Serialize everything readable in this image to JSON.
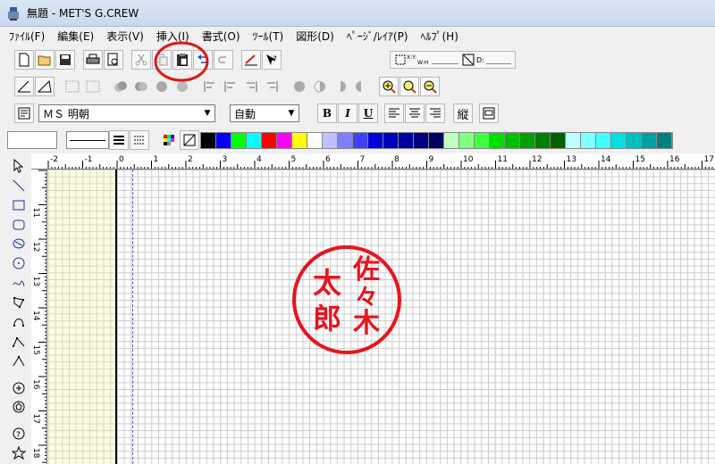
{
  "window": {
    "title": "無題 - MET'S G.CREW"
  },
  "menu": [
    {
      "label": "ﾌｧｲﾙ(F)"
    },
    {
      "label": "編集(E)"
    },
    {
      "label": "表示(V)"
    },
    {
      "label": "挿入(I)"
    },
    {
      "label": "書式(O)"
    },
    {
      "label": "ﾂｰﾙ(T)"
    },
    {
      "label": "図形(D)"
    },
    {
      "label": "ﾍﾟｰｼﾞ/ﾚｲｱ(P)"
    },
    {
      "label": "ﾍﾙﾌﾟ(H)"
    }
  ],
  "font_toolbar": {
    "font_name": "ＭＳ 明朝",
    "font_size": "自動",
    "bold": "B",
    "italic": "I",
    "underline": "U",
    "vertical": "縦"
  },
  "coord_panel": {
    "d_label": "D:"
  },
  "ruler": {
    "h_labels": [
      "-2",
      "-1",
      "0",
      "1",
      "2",
      "3",
      "4",
      "5",
      "6",
      "7",
      "8",
      "9",
      "10",
      "11",
      "12",
      "13",
      "14",
      "15",
      "16",
      "17"
    ],
    "v_labels": [
      "11",
      "12",
      "13",
      "14",
      "15",
      "16",
      "17",
      "18"
    ]
  },
  "palette_colors": [
    "#000000",
    "#0000ff",
    "#00ff00",
    "#00ffff",
    "#ff0000",
    "#ff00ff",
    "#ffff00",
    "#ffffff",
    "#c0c0ff",
    "#8080ff",
    "#4040ff",
    "#0000e0",
    "#0000c0",
    "#0000a0",
    "#000080",
    "#000060",
    "#c0ffc0",
    "#80ff80",
    "#40ff40",
    "#00e000",
    "#00c000",
    "#00a000",
    "#008000",
    "#006000",
    "#c0ffff",
    "#80ffff",
    "#40ffff",
    "#00e0e0",
    "#00c0c0",
    "#00a0a0",
    "#008080"
  ],
  "stamp": {
    "color": "#e8141e",
    "line1": [
      "佐",
      "々",
      "木"
    ],
    "line2": [
      "太",
      "郎"
    ]
  },
  "annotation": {
    "color": "#e01818"
  }
}
